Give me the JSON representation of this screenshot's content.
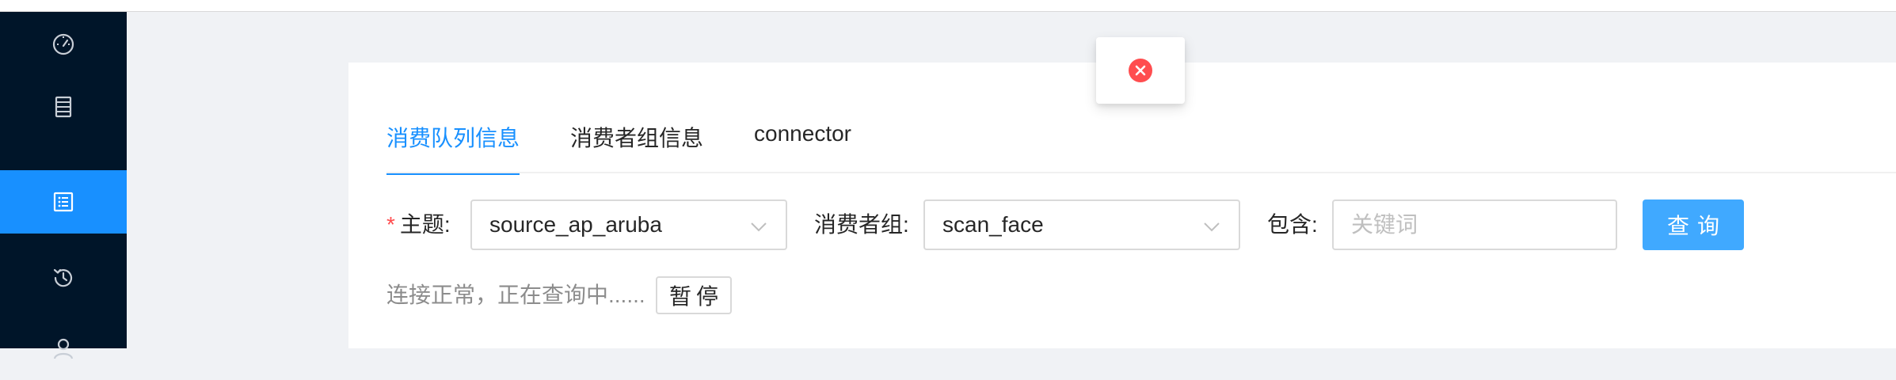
{
  "colors": {
    "sidebar_bg": "#001529",
    "active": "#1890ff",
    "primary_button": "#40a9ff",
    "error": "#ff4d4f",
    "required_mark": "#ff4d4f"
  },
  "sidebar": {
    "items": [
      {
        "icon": "dashboard-icon",
        "active": false
      },
      {
        "icon": "server-icon",
        "active": false
      },
      {
        "icon": "list-icon",
        "active": true
      },
      {
        "icon": "history-icon",
        "active": false
      },
      {
        "icon": "user-icon",
        "active": false
      }
    ]
  },
  "tabs": [
    {
      "label": "消费队列信息",
      "active": true
    },
    {
      "label": "消费者组信息",
      "active": false
    },
    {
      "label": "connector",
      "active": false
    }
  ],
  "form": {
    "required_mark": "*",
    "topic_label": "主题:",
    "topic_value": "source_ap_aruba",
    "group_label": "消费者组:",
    "group_value": "scan_face",
    "contains_label": "包含:",
    "contains_placeholder": "关键词",
    "contains_value": "",
    "query_button": "查询"
  },
  "status": {
    "text": "连接正常，正在查询中......",
    "pause_button": "暂停"
  },
  "toast": {
    "icon": "error-icon"
  }
}
